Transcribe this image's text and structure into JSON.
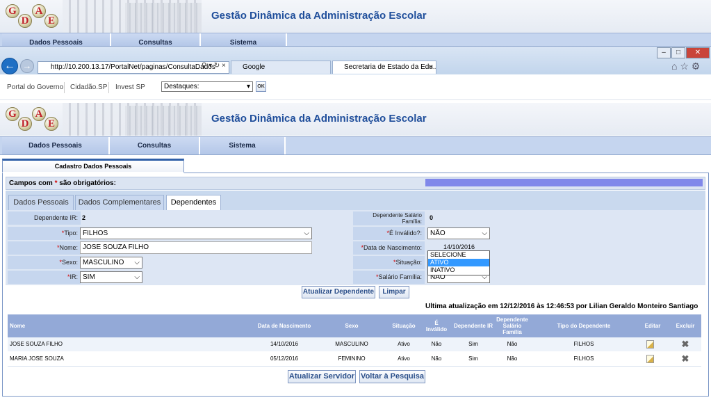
{
  "header": {
    "logo_letters": [
      "G",
      "D",
      "A",
      "E"
    ],
    "title": "Gestão Dinâmica da Administração Escolar"
  },
  "menu": {
    "items": [
      "Dados Pessoais",
      "Consultas",
      "Sistema"
    ]
  },
  "browser": {
    "address": "http://10.200.13.17/PortalNet/paginas/ConsultaDados",
    "tabs": [
      "Google",
      "Secretaria de Estado da Edu..."
    ],
    "tab_close": "×",
    "window_buttons": [
      "–",
      "□",
      "✕"
    ]
  },
  "links": {
    "items": [
      "Portal do Governo",
      "Cidadão.SP",
      "Invest SP"
    ],
    "destaques_value": "Destaques:",
    "ok_label": "OK"
  },
  "page_tab": "Cadastro Dados Pessoais",
  "required_note": {
    "before": "Campos com ",
    "star": "*",
    "after": " são obrigatórios:"
  },
  "form_tabs": [
    "Dados Pessoais",
    "Dados Complementares",
    "Dependentes"
  ],
  "form": {
    "dependente_ir_label": "Dependente IR:",
    "dependente_ir_value": "2",
    "salario_familia_label": "Dependente Salário Família:",
    "salario_familia_value": "0",
    "tipo_label": "Tipo:",
    "tipo_value": "FILHOS",
    "invalido_label": "É Inválido?:",
    "invalido_value": "NÃO",
    "nome_label": "Nome:",
    "nome_value": "JOSE SOUZA FILHO",
    "nascimento_label": "Data de Nascimento:",
    "nascimento_value": "14/10/2016",
    "sexo_label": "Sexo:",
    "sexo_value": "MASCULINO",
    "situacao_label": "Situação:",
    "situacao_options": [
      "SELECIONE",
      "ATIVO",
      "INATIVO"
    ],
    "ir_label": "IR:",
    "ir_value": "SIM",
    "sal_fam_label": "Salário Família:",
    "sal_fam_value": "NÃO",
    "required_star": "*"
  },
  "buttons": {
    "atualizar_dependente": "Atualizar Dependente",
    "limpar": "Limpar",
    "atualizar_servidor": "Atualizar Servidor",
    "voltar": "Voltar à Pesquisa"
  },
  "last_update": "Ultima atualização em 12/12/2016 às 12:46:53 por Lilian Geraldo Monteiro Santiago",
  "table": {
    "headers": [
      "Nome",
      "Data de Nascimento",
      "Sexo",
      "Situação",
      "É Inválido",
      "Dependente IR",
      "Dependente Salário Família",
      "Tipo do Dependente",
      "Editar",
      "Excluir"
    ],
    "rows": [
      [
        "JOSE SOUZA FILHO",
        "14/10/2016",
        "MASCULINO",
        "Ativo",
        "Não",
        "Sim",
        "Não",
        "FILHOS"
      ],
      [
        "MARIA JOSE SOUZA",
        "05/12/2016",
        "FEMININO",
        "Ativo",
        "Não",
        "Sim",
        "Não",
        "FILHOS"
      ]
    ]
  },
  "icons": {
    "edit": "edit-icon",
    "delete": "delete-icon",
    "back": "back-icon",
    "forward": "forward-icon",
    "home": "home-icon",
    "star": "star-icon",
    "gear": "gear-icon"
  }
}
